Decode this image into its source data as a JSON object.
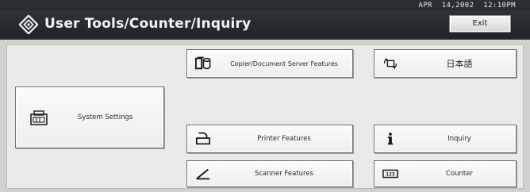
{
  "header": {
    "title": "User Tools/Counter/Inquiry",
    "date": "APR",
    "date_value": "14,2002",
    "time": "12:10PM",
    "exit_label": "Exit"
  },
  "buttons": {
    "system_settings": {
      "label": "System Settings",
      "icon": "system-settings-icon"
    },
    "copier": {
      "label": "Copier/Document Server Features",
      "icon": "copier-document-server-icon"
    },
    "printer": {
      "label": "Printer Features",
      "icon": "printer-icon"
    },
    "scanner": {
      "label": "Scanner Features",
      "icon": "scanner-icon"
    },
    "language": {
      "label": "日本語",
      "icon": "language-switch-icon"
    },
    "inquiry": {
      "label": "Inquiry",
      "icon": "info-icon"
    },
    "counter": {
      "label": "Counter",
      "icon": "counter-icon"
    }
  },
  "colors": {
    "header_bg": "#25282c",
    "panel_bg": "#e9ebe8",
    "button_border": "#6f736f"
  }
}
